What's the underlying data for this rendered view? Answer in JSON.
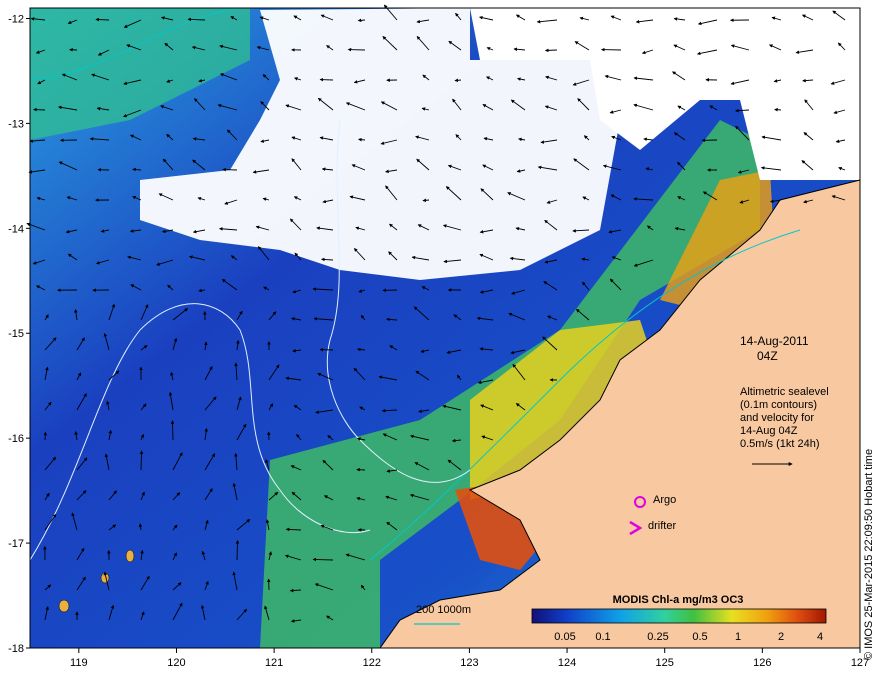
{
  "map": {
    "x_ticks": [
      "119",
      "120",
      "121",
      "122",
      "123",
      "124",
      "125",
      "126",
      "127"
    ],
    "y_ticks": [
      "-12",
      "-13",
      "-14",
      "-15",
      "-16",
      "-17",
      "-18"
    ],
    "lon_range": [
      118.5,
      127
    ],
    "lat_range": [
      -18,
      -11.9
    ]
  },
  "annotation": {
    "date": "14-Aug-2011",
    "time": "04Z",
    "desc_lines": [
      "Altimetric sealevel",
      "(0.1m contours)",
      "and velocity for",
      "14-Aug 04Z",
      "0.5m/s (1kt 24h)"
    ]
  },
  "legend": {
    "argo": "Argo",
    "drifter": "drifter",
    "argo_color": "#e000e0",
    "drifter_color": "#e000e0",
    "depth": "200  1000m",
    "depth_color": "#00c8c8"
  },
  "colorbar": {
    "title": "MODIS Chl-a mg/m3 OC3",
    "labels": [
      "0.05",
      "0.1",
      "0.25",
      "0.5",
      "1",
      "2",
      "4"
    ],
    "colors": [
      "#10107a",
      "#1040c8",
      "#10a0e8",
      "#30d0a0",
      "#40c040",
      "#e8e020",
      "#f0a010",
      "#e05010",
      "#a01800"
    ]
  },
  "credit": "© IMOS 25-Mar-2015 22:09:50 Hobart time",
  "colors": {
    "land": "#f8c8a0",
    "coast": "#000000",
    "ocean_deep": "#1a3ab8",
    "ocean_mid": "#10a0e0",
    "shelf": "#30d0a0",
    "cloud": "#ffffff"
  }
}
